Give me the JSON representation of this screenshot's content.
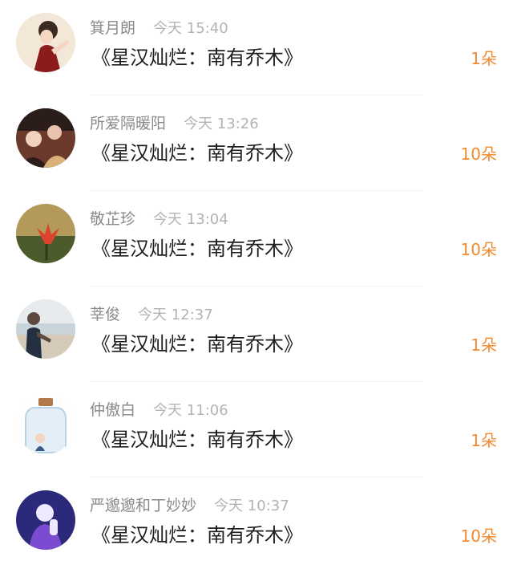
{
  "gift_list": [
    {
      "name": "箕月朗",
      "time": "今天 15:40",
      "title": "《星汉灿烂：南有乔木》",
      "count": "1朵",
      "avatar_icon": "anime-boy-avatar-icon",
      "avatar_colors": [
        "#f3e7d8",
        "#8c1b1b",
        "#3b2a22"
      ]
    },
    {
      "name": "所爱隔暖阳",
      "time": "今天 13:26",
      "title": "《星汉灿烂：南有乔木》",
      "count": "10朵",
      "avatar_icon": "drama-scene-avatar-icon",
      "avatar_colors": [
        "#6b3a2d",
        "#d8b27a",
        "#2b1d1a"
      ]
    },
    {
      "name": "敬芷珍",
      "time": "今天 13:04",
      "title": "《星汉灿烂：南有乔木》",
      "count": "10朵",
      "avatar_icon": "red-flower-avatar-icon",
      "avatar_colors": [
        "#b39a5a",
        "#d9452e",
        "#4c5b2b"
      ]
    },
    {
      "name": "莘俊",
      "time": "今天 12:37",
      "title": "《星汉灿烂：南有乔木》",
      "count": "1朵",
      "avatar_icon": "person-beach-avatar-icon",
      "avatar_colors": [
        "#e7ebee",
        "#5e4b3f",
        "#223041"
      ]
    },
    {
      "name": "仲傲白",
      "time": "今天 11:06",
      "title": "《星汉灿烂：南有乔木》",
      "count": "1朵",
      "avatar_icon": "bottle-avatar-icon",
      "avatar_colors": [
        "#ffffff",
        "#b9d3e6",
        "#3a5a86"
      ]
    },
    {
      "name": "严邈邈和丁妙妙",
      "time": "今天 10:37",
      "title": "《星汉灿烂：南有乔木》",
      "count": "10朵",
      "avatar_icon": "singer-purple-avatar-icon",
      "avatar_colors": [
        "#2b2a7a",
        "#7b4bd1",
        "#efe9ff"
      ]
    }
  ]
}
